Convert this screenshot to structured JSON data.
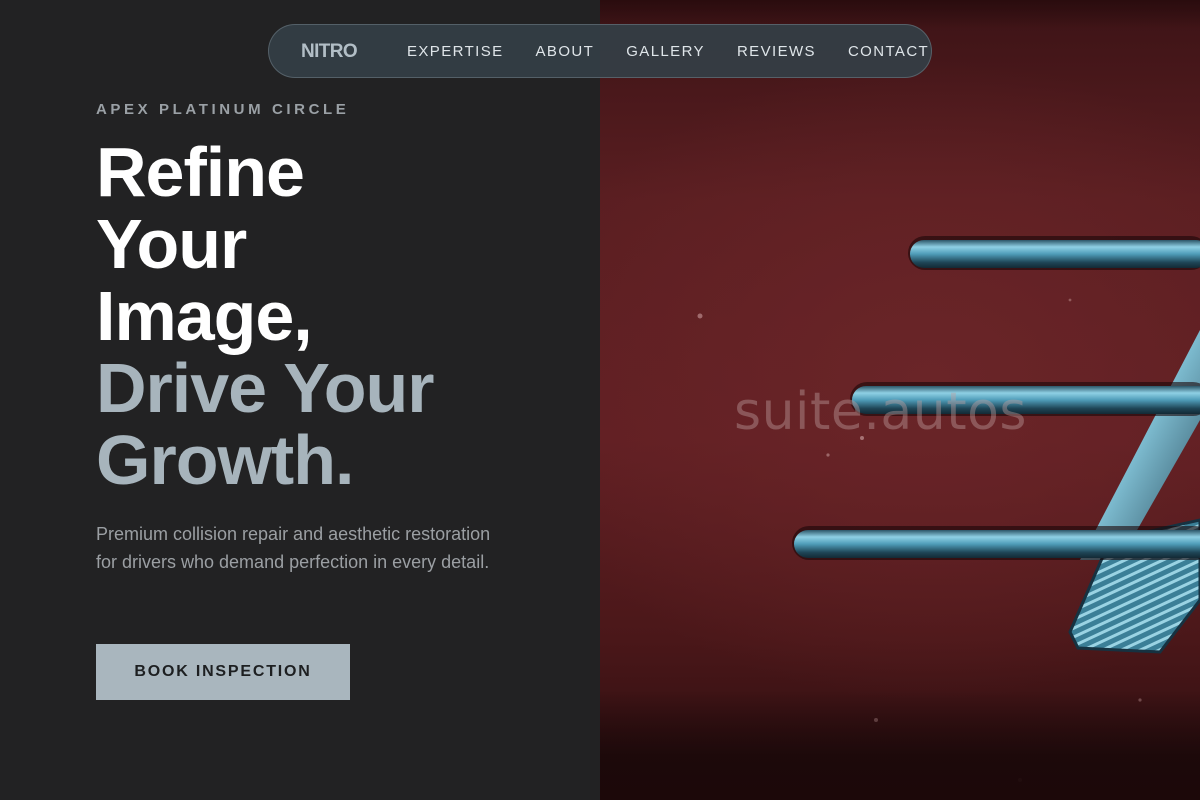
{
  "nav": {
    "logo": "NITRO",
    "links": [
      {
        "label": "EXPERTISE"
      },
      {
        "label": "ABOUT"
      },
      {
        "label": "GALLERY"
      },
      {
        "label": "REVIEWS"
      },
      {
        "label": "CONTACT"
      }
    ]
  },
  "hero": {
    "eyebrow": "APEX PLATINUM CIRCLE",
    "headline_white": [
      "Refine",
      "Your",
      "Image,"
    ],
    "headline_accent": [
      "Drive Your",
      "Growth."
    ],
    "description": "Premium collision repair and aesthetic restoration for drivers who demand perfection in every detail.",
    "cta_label": "BOOK INSPECTION"
  },
  "image": {
    "watermark": "suite.autos"
  },
  "colors": {
    "background": "#222223",
    "accent": "#a7b4bc",
    "button": "#a9b6be",
    "car_paint": "#5e1e21",
    "chrome": "#5ea9c4"
  }
}
